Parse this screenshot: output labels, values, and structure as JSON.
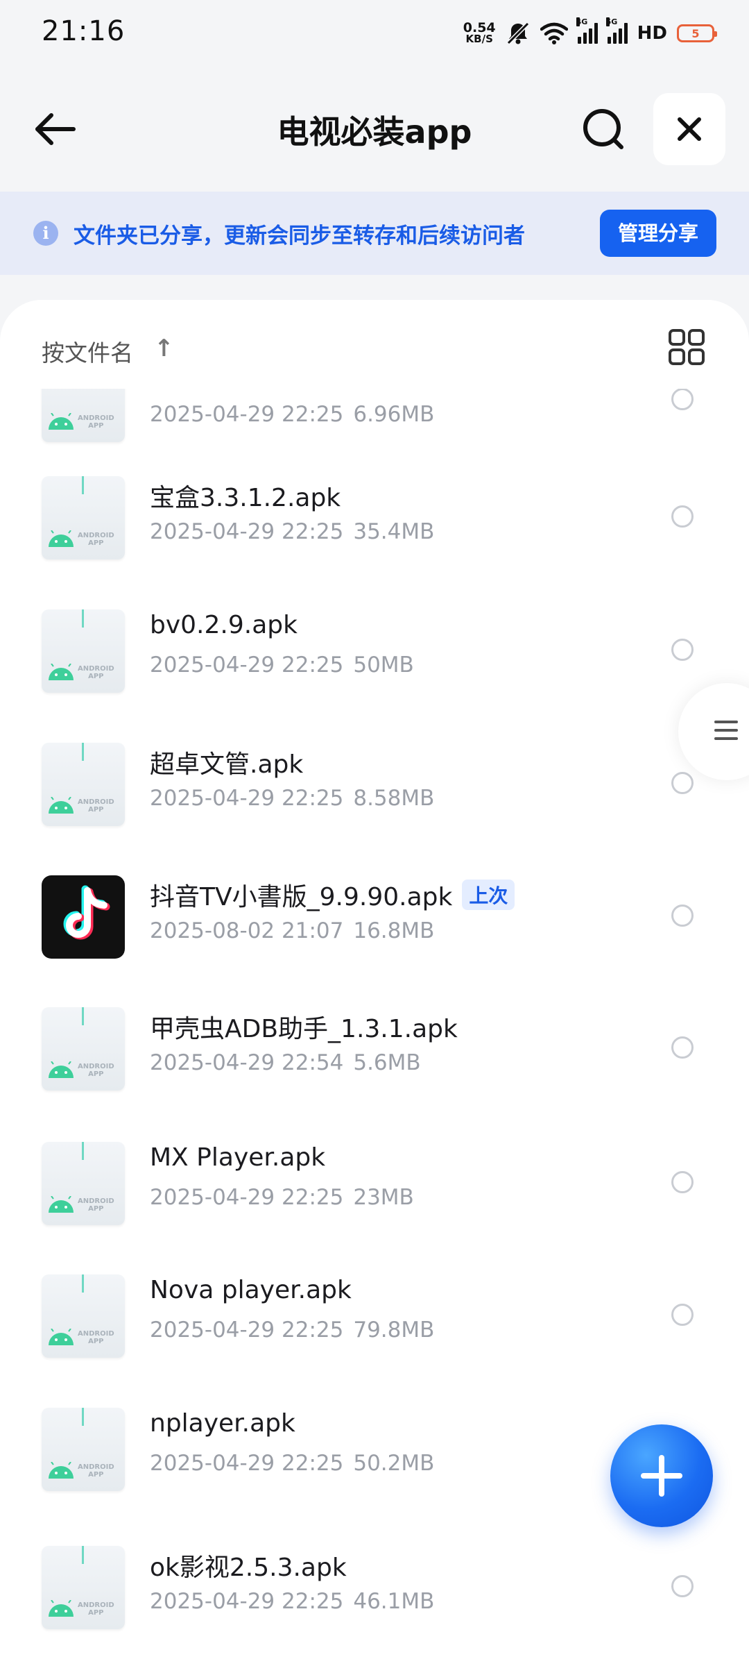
{
  "status_bar": {
    "time": "21:16",
    "net_speed_value": "0.54",
    "net_speed_unit": "KB/S",
    "signal_1_tag": "4G",
    "signal_2_tag": "5G",
    "hd_label": "HD",
    "battery_level": "5"
  },
  "header": {
    "title": "电视必装app",
    "back_icon": "arrow-left-icon",
    "search_icon": "search-icon",
    "close_icon": "close-icon"
  },
  "banner": {
    "text": "文件夹已分享，更新会同步至转存和后续访问者",
    "button_label": "管理分享",
    "accent": "#1662f0"
  },
  "sortbar": {
    "label": "按文件名",
    "direction": "↑",
    "view_icon": "grid-view-icon"
  },
  "thumb_label": {
    "line1": "ANDROID",
    "line2": "APP"
  },
  "files": [
    {
      "name": "",
      "date": "2025-04-29 22:25",
      "size": "6.96MB",
      "icon": "android-apk-icon",
      "tag": ""
    },
    {
      "name": "宝盒3.3.1.2.apk",
      "date": "2025-04-29 22:25",
      "size": "35.4MB",
      "icon": "android-apk-icon",
      "tag": ""
    },
    {
      "name": "bv0.2.9.apk",
      "date": "2025-04-29 22:25",
      "size": "50MB",
      "icon": "android-apk-icon",
      "tag": ""
    },
    {
      "name": "超卓文管.apk",
      "date": "2025-04-29 22:25",
      "size": "8.58MB",
      "icon": "android-apk-icon",
      "tag": ""
    },
    {
      "name": "抖音TV小書版_9.9.90.apk",
      "date": "2025-08-02 21:07",
      "size": "16.8MB",
      "icon": "tiktok-icon",
      "tag": "上次"
    },
    {
      "name": "甲壳虫ADB助手_1.3.1.apk",
      "date": "2025-04-29 22:54",
      "size": "5.6MB",
      "icon": "android-apk-icon",
      "tag": ""
    },
    {
      "name": "MX Player.apk",
      "date": "2025-04-29 22:25",
      "size": "23MB",
      "icon": "android-apk-icon",
      "tag": ""
    },
    {
      "name": "Nova player.apk",
      "date": "2025-04-29 22:25",
      "size": "79.8MB",
      "icon": "android-apk-icon",
      "tag": ""
    },
    {
      "name": "nplayer.apk",
      "date": "2025-04-29 22:25",
      "size": "50.2MB",
      "icon": "android-apk-icon",
      "tag": ""
    },
    {
      "name": "ok影视2.5.3.apk",
      "date": "2025-04-29 22:25",
      "size": "46.1MB",
      "icon": "android-apk-icon",
      "tag": ""
    }
  ],
  "side_handle_icon": "menu-lines-icon",
  "fab_icon": "plus-icon"
}
